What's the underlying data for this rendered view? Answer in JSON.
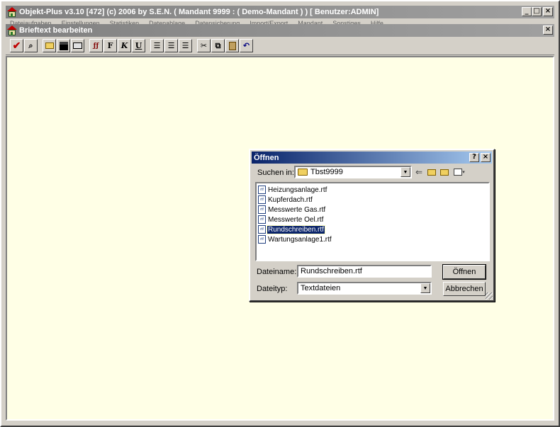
{
  "app": {
    "title": "Objekt-Plus  v3.10 [472]     (c) 2006 by S.E.N.     ( Mandant 9999 : ( Demo-Mandant ) ) [ Benutzer:ADMIN]",
    "menu": [
      "Dateiaufgaben",
      "Einstellungen",
      "Statistiken",
      "Datenablage",
      "Datensicherung",
      "Import/Export",
      "Mandant",
      "Sonstiges",
      "Hilfe"
    ]
  },
  "document_window": {
    "title": "Brieftext bearbeiten"
  },
  "toolbar": {
    "bold_label": "F",
    "italic_label": "K",
    "underline_label": "U"
  },
  "dialog": {
    "title": "Öffnen",
    "help_label": "?",
    "close_label": "×",
    "look_in_label": "Suchen in:",
    "look_in_value": "Tbst9999",
    "files": [
      {
        "name": "Heizungsanlage.rtf"
      },
      {
        "name": "Kupferdach.rtf"
      },
      {
        "name": "Messwerte Gas.rtf"
      },
      {
        "name": "Messwerte Oel.rtf"
      },
      {
        "name": "Rundschreiben.rtf"
      },
      {
        "name": "Wartungsanlage1.rtf"
      }
    ],
    "selected_file": "Rundschreiben.rtf",
    "filename_label": "Dateiname:",
    "filename_value": "Rundschreiben.rtf",
    "filetype_label": "Dateityp:",
    "filetype_value": "Textdateien",
    "open_button": "Öffnen",
    "cancel_button": "Abbrechen"
  }
}
